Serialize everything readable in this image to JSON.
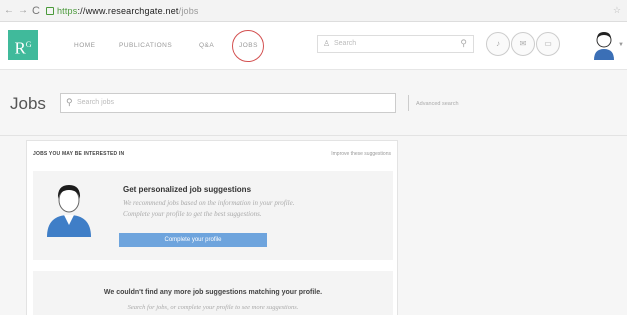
{
  "browser": {
    "back": "←",
    "forward": "→",
    "reload": "C",
    "url_protocol": "https",
    "url_host": "://www.researchgate.net",
    "url_path": "/jobs"
  },
  "header": {
    "logo": "R",
    "logo_sup": "G",
    "nav": [
      "HOME",
      "PUBLICATIONS",
      "Q&A",
      "JOBS"
    ],
    "search_placeholder": "Search",
    "search_icon": "search-icon",
    "circle_buttons": [
      "bell-icon",
      "envelope-icon",
      "chat-icon"
    ],
    "accent": "#40ba9b",
    "highlight_color": "#d35050"
  },
  "jobs_bar": {
    "title": "Jobs",
    "search_placeholder": "Search jobs",
    "advanced": "Advanced search"
  },
  "suggestions": {
    "heading": "JOBS YOU MAY BE INTERESTED IN",
    "link": "Improve these suggestions",
    "card_title": "Get personalized job suggestions",
    "card_desc_1": "We recommend jobs based on the information in your profile.",
    "card_desc_2": "Complete your profile to get the best suggestions.",
    "button": "Complete your profile",
    "button_color": "#6ea4dd",
    "nomore_title": "We couldn't find any more job suggestions matching your profile.",
    "nomore_sub": "Search for jobs, or complete your profile to see more suggestions."
  }
}
